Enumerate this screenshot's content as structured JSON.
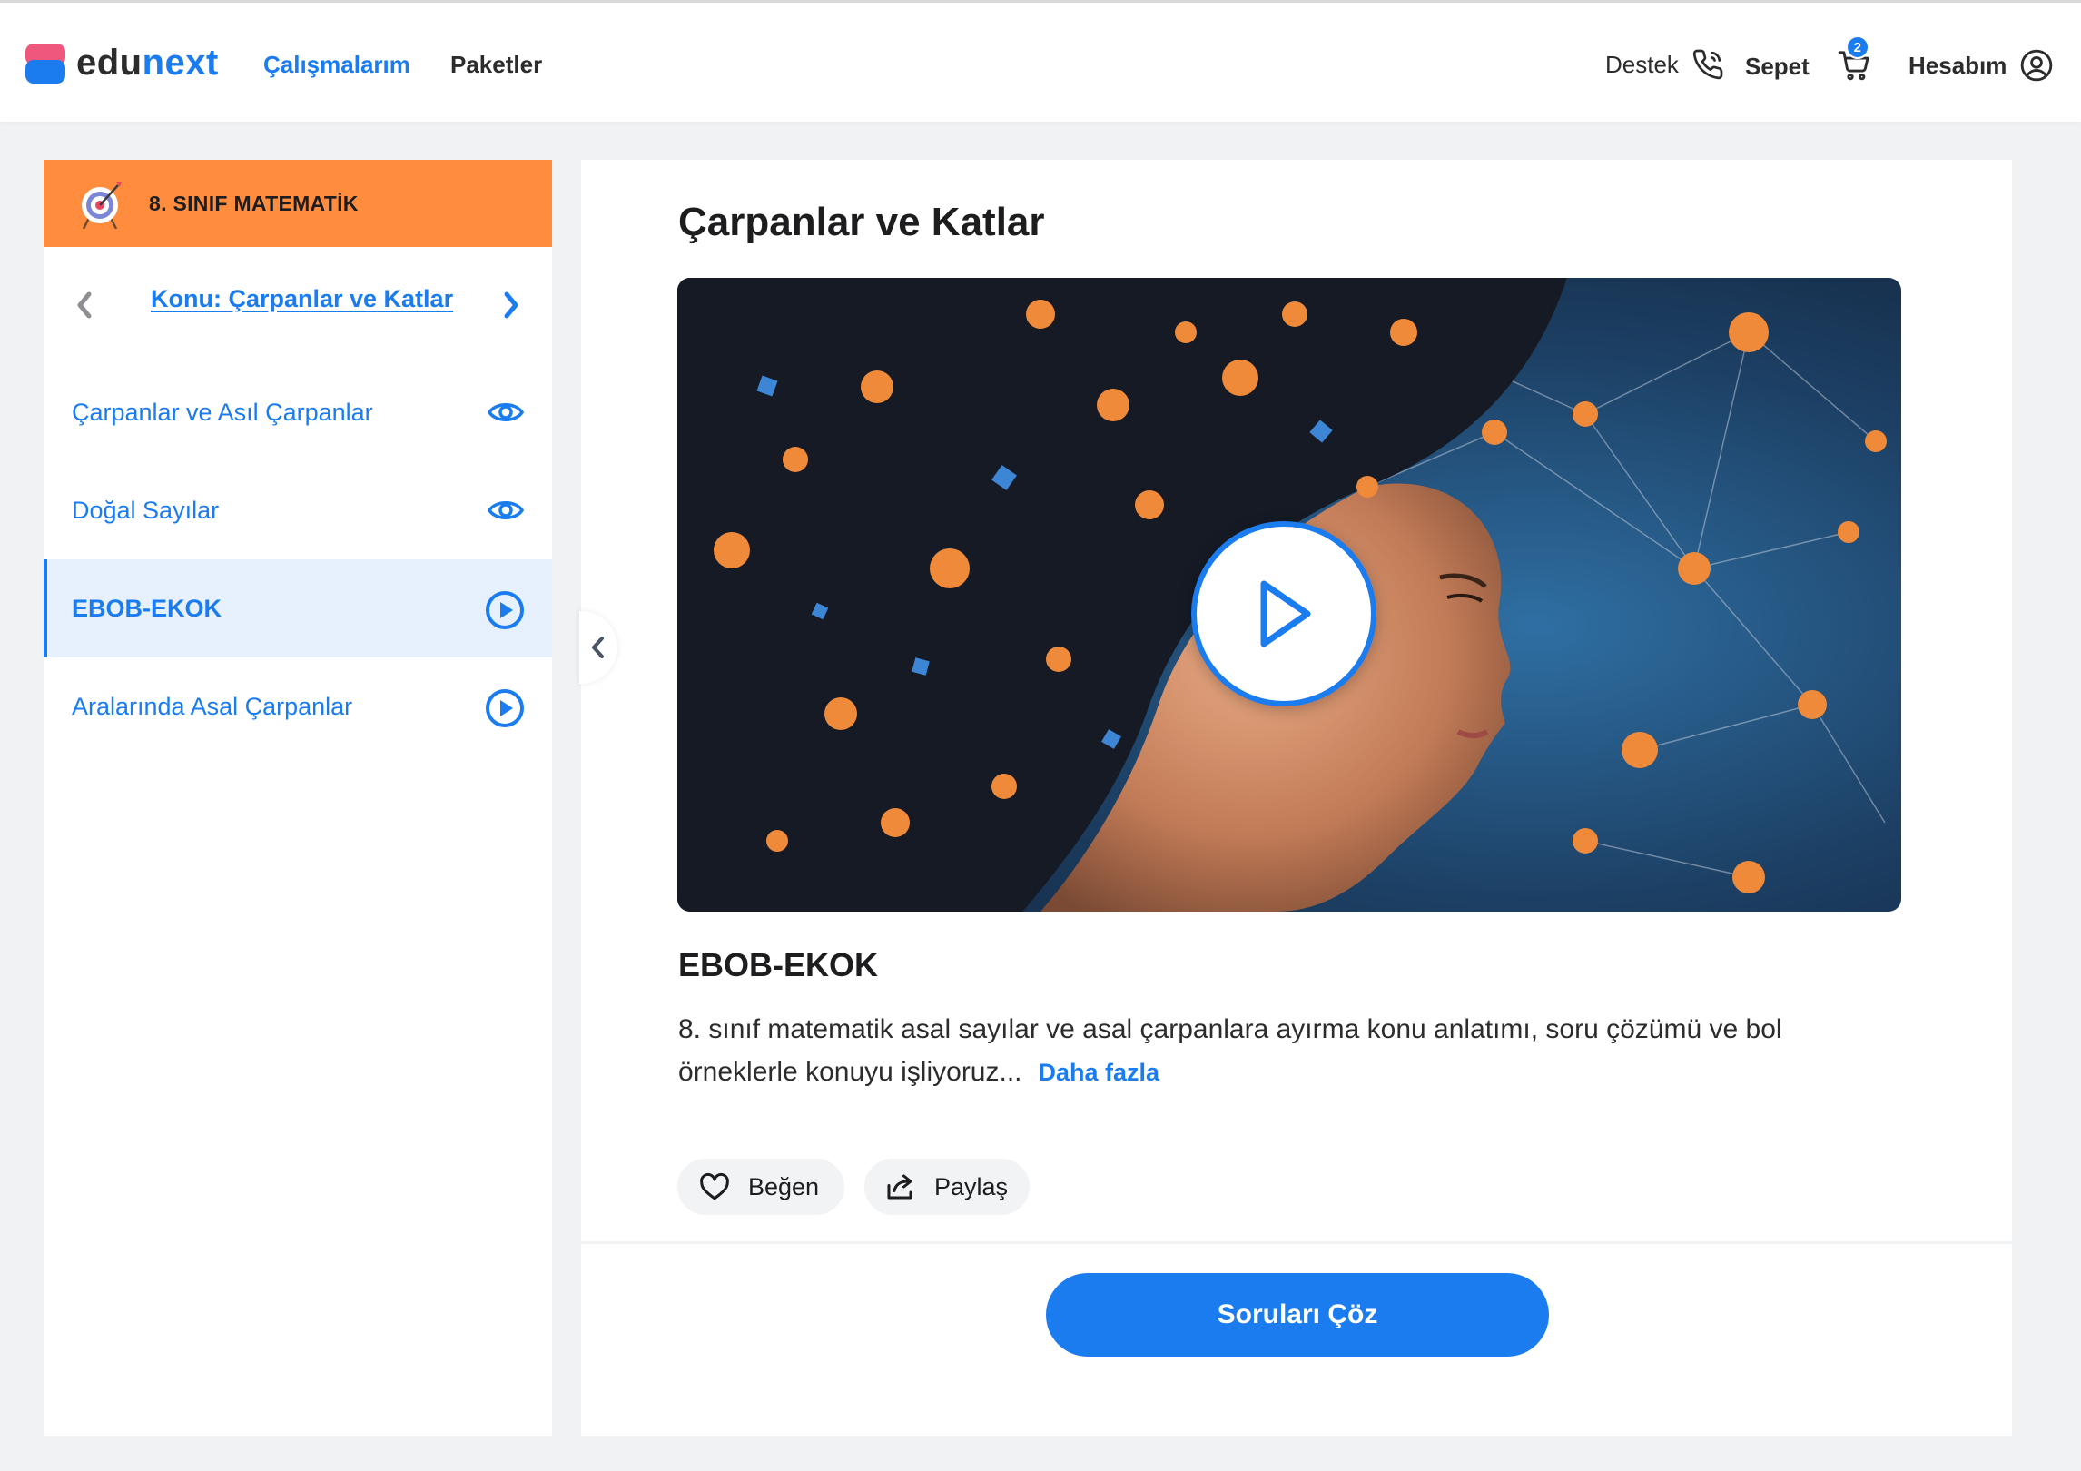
{
  "header": {
    "logo": {
      "part1": "edu",
      "part2": "next"
    },
    "nav": [
      {
        "label": "Çalışmalarım",
        "active": true
      },
      {
        "label": "Paketler",
        "active": false
      }
    ],
    "support_label": "Destek",
    "support_icon": "phone-icon",
    "cart_label": "Sepet",
    "cart_icon": "cart-icon",
    "cart_count": "2",
    "account_label": "Hesabım",
    "account_icon": "user-circle-icon"
  },
  "sidebar": {
    "course_title": "8. SINIF MATEMATİK",
    "course_icon": "target-icon",
    "topic_title": "Konu: Çarpanlar ve Katlar",
    "lessons": [
      {
        "label": "Çarpanlar ve Asıl Çarpanlar",
        "icon": "eye-icon",
        "active": false
      },
      {
        "label": "Doğal Sayılar",
        "icon": "eye-icon",
        "active": false
      },
      {
        "label": "EBOB-EKOK",
        "icon": "play-circle-icon",
        "active": true
      },
      {
        "label": "Aralarında Asal Çarpanlar",
        "icon": "play-circle-icon",
        "active": false
      }
    ]
  },
  "main": {
    "title": "Çarpanlar ve Katlar",
    "lesson_title": "EBOB-EKOK",
    "description": "8. sınıf matematik asal sayılar ve asal çarpanlara ayırma konu anlatımı, soru çözümü ve bol örneklerle konuyu işliyoruz...",
    "more_label": "Daha fazla",
    "like_label": "Beğen",
    "share_label": "Paylaş",
    "solve_label": "Soruları Çöz"
  },
  "colors": {
    "accent": "#1b7cf0",
    "course_header": "#ff8d3d",
    "active_row": "#e6f1fd",
    "logo_pink": "#f0577d"
  }
}
